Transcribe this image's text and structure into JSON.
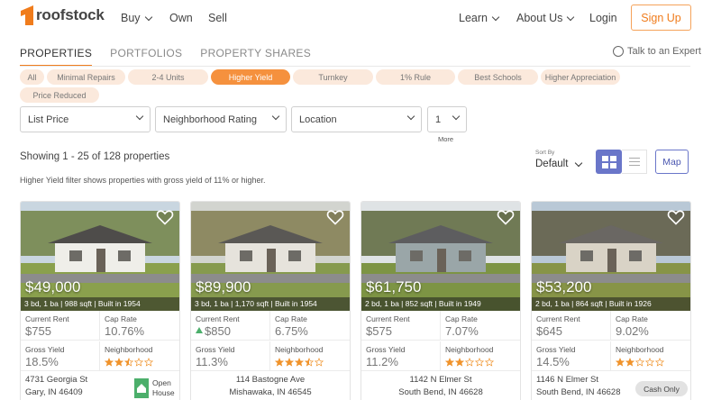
{
  "brand": {
    "name": "roofstock",
    "accent": "#f07c1c"
  },
  "nav": {
    "buy": "Buy",
    "own": "Own",
    "sell": "Sell",
    "learn": "Learn",
    "about": "About Us",
    "login": "Login",
    "signup": "Sign Up"
  },
  "tabs": [
    "PROPERTIES",
    "PORTFOLIOS",
    "PROPERTY SHARES"
  ],
  "talk_expert": "Talk to an Expert",
  "chips": [
    "All",
    "Minimal Repairs",
    "2-4 Units",
    "Higher Yield",
    "Turnkey",
    "1% Rule",
    "Best Schools",
    "Higher Appreciation",
    "Price Reduced"
  ],
  "active_chip": "Higher Yield",
  "filters": {
    "list_price": "List Price",
    "neighborhood": "Neighborhood Rating",
    "location": "Location",
    "count": "1",
    "more": "More"
  },
  "results": {
    "showing": "Showing 1 - 25 of 128 properties",
    "note": "Higher Yield filter shows properties with gross yield of 11% or higher.",
    "sort_label": "Sort By",
    "sort_value": "Default",
    "map": "Map"
  },
  "labels": {
    "current_rent": "Current Rent",
    "cap_rate": "Cap Rate",
    "gross_yield": "Gross Yield",
    "neighborhood": "Neighborhood"
  },
  "cards": [
    {
      "price": "$49,000",
      "specs": "3 bd, 1 ba | 988 sqft | Built in 1954",
      "rent": "$755",
      "cap": "10.76%",
      "gross": "18.5%",
      "rating": 2.5,
      "addr1": "4731 Georgia St",
      "addr2": "Gary, IN 46409",
      "badge": "Open House",
      "rent_trend": false
    },
    {
      "price": "$89,900",
      "specs": "3 bd, 1 ba | 1,170 sqft | Built in 1954",
      "rent": "$850",
      "cap": "6.75%",
      "gross": "11.3%",
      "rating": 3.5,
      "addr1": "114 Bastogne Ave",
      "addr2": "Mishawaka, IN 46545",
      "badge": "",
      "rent_trend": true
    },
    {
      "price": "$61,750",
      "specs": "2 bd, 1 ba | 852 sqft | Built in 1949",
      "rent": "$575",
      "cap": "7.07%",
      "gross": "11.2%",
      "rating": 2,
      "addr1": "1142 N Elmer St",
      "addr2": "South Bend, IN 46628",
      "badge": "",
      "rent_trend": false
    },
    {
      "price": "$53,200",
      "specs": "2 bd, 1 ba | 864 sqft | Built in 1926",
      "rent": "$645",
      "cap": "9.02%",
      "gross": "14.5%",
      "rating": 2,
      "addr1": "1146 N Elmer St",
      "addr2": "South Bend, IN 46628",
      "badge": "Cash Only",
      "rent_trend": false
    }
  ]
}
